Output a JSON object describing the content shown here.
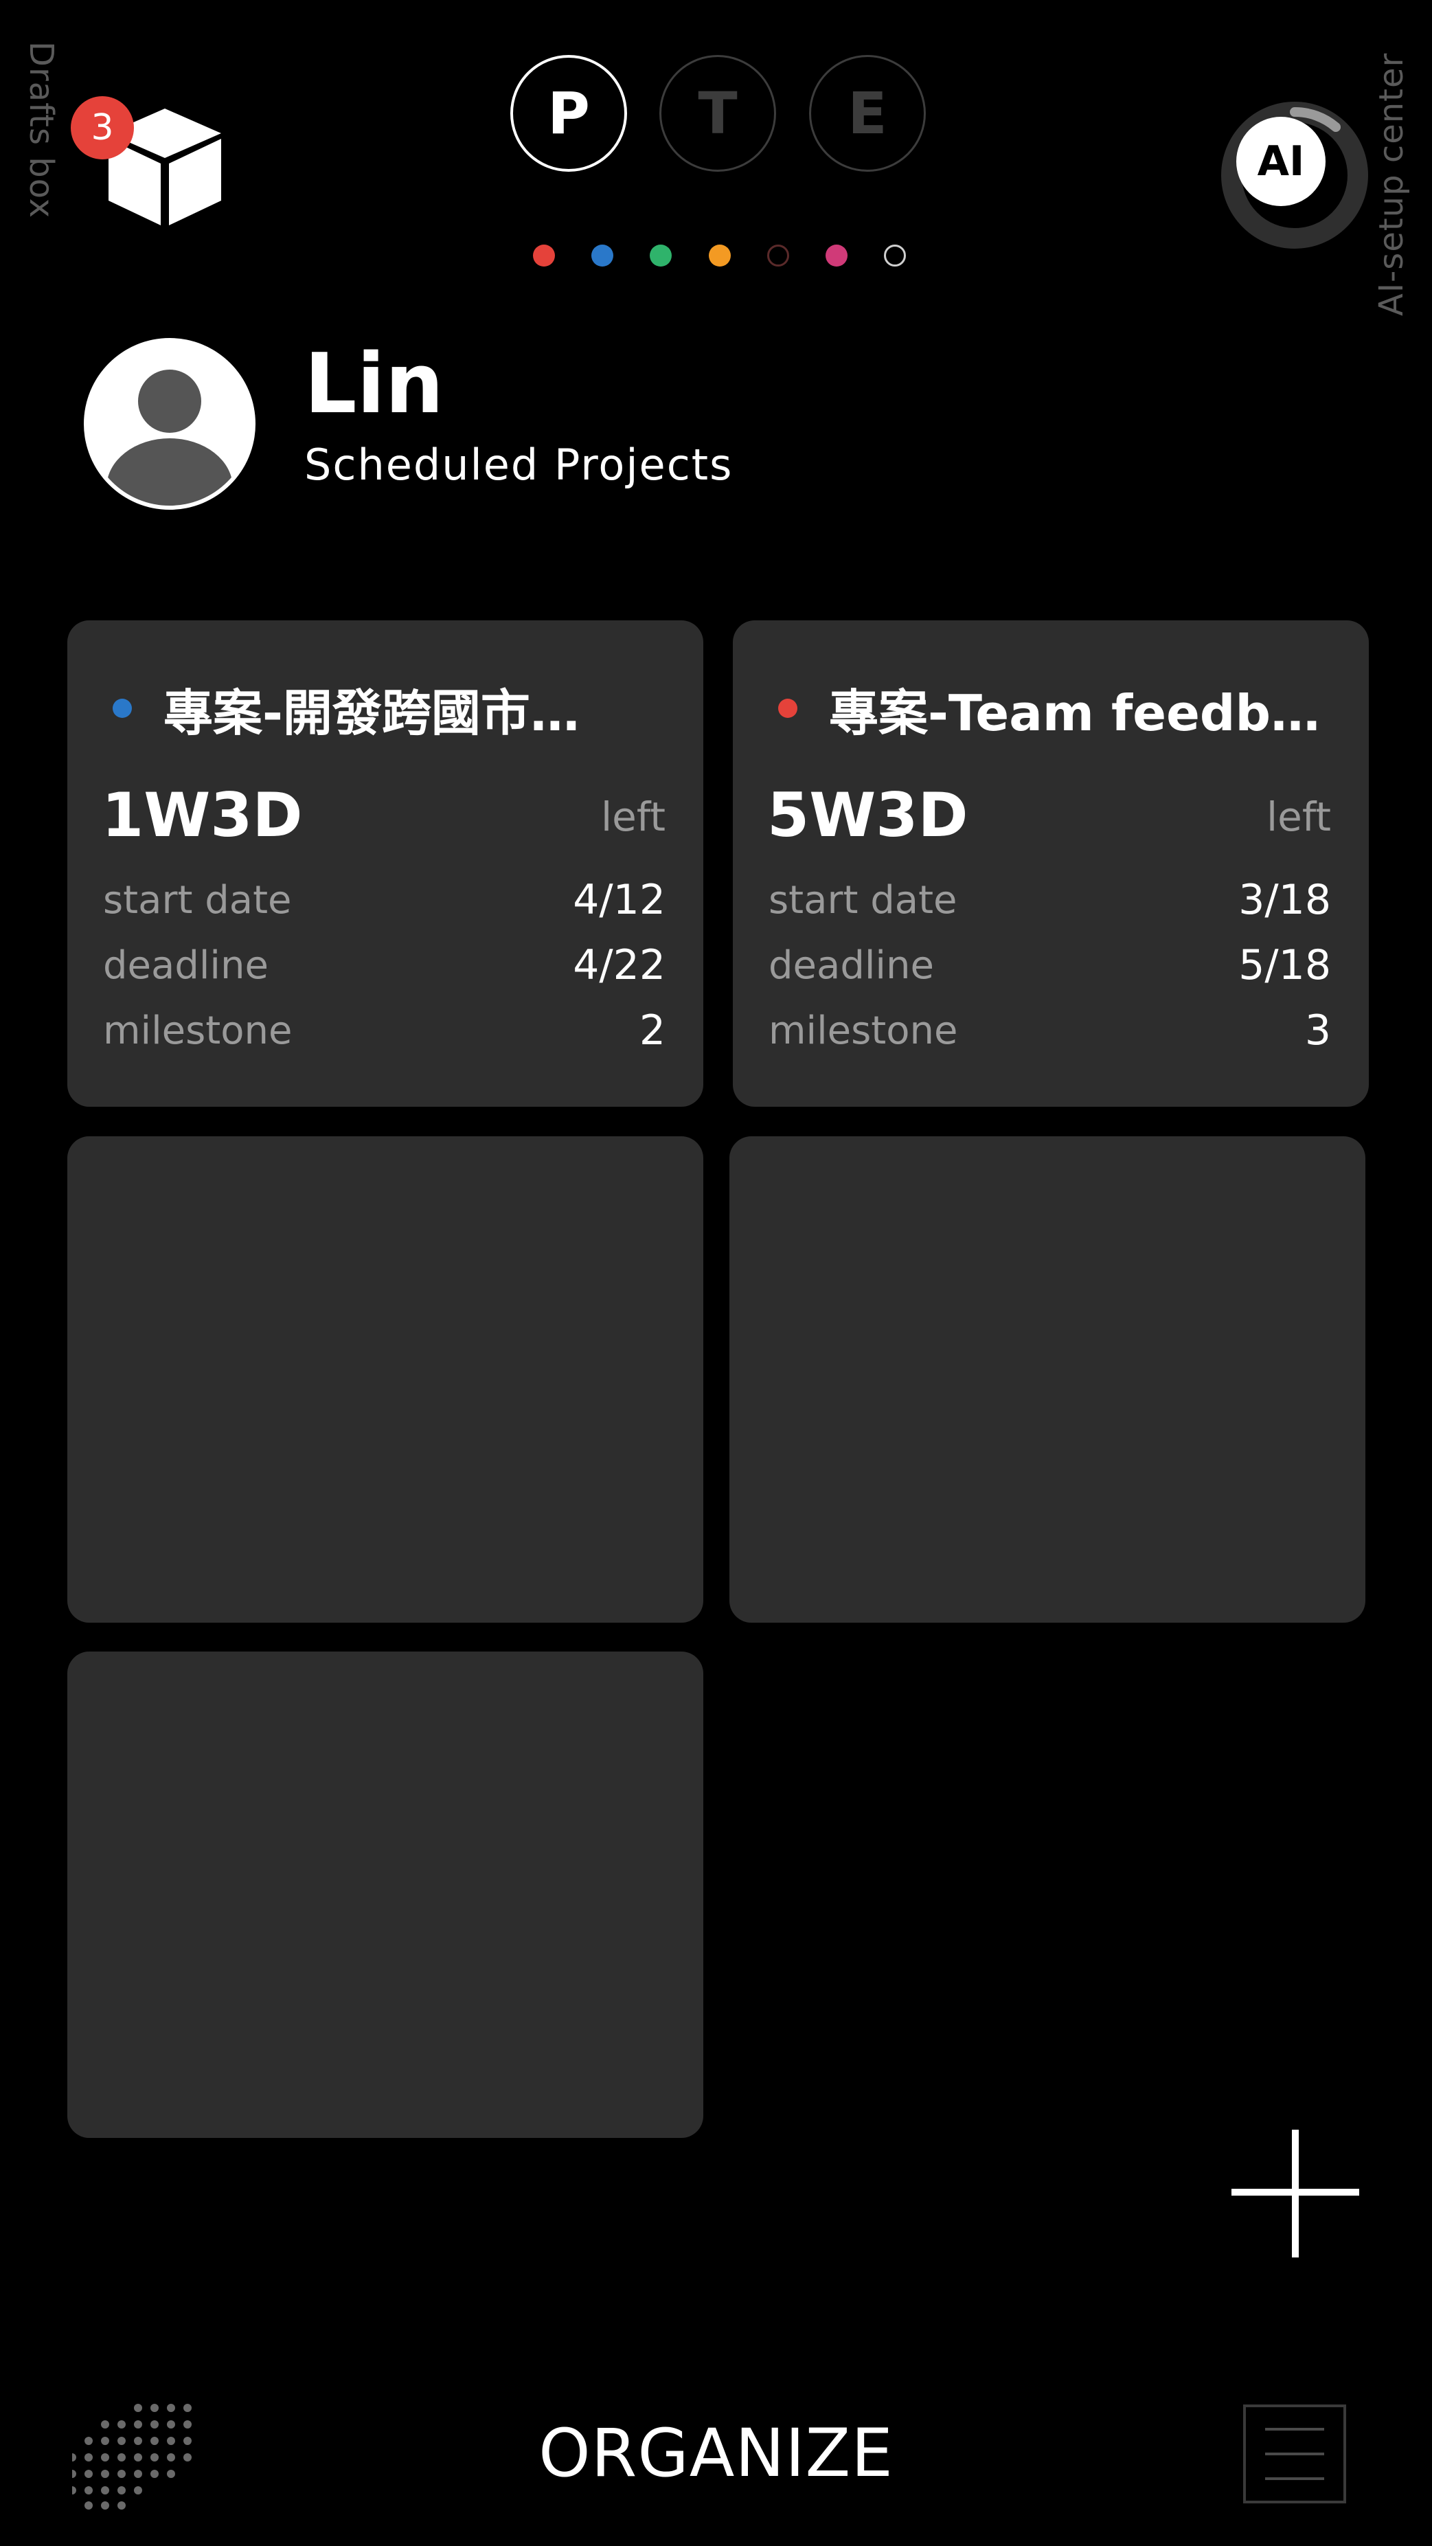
{
  "drafts": {
    "label": "Drafts box",
    "badge_count": "3",
    "icon": "cube-icon"
  },
  "mode_tabs": [
    {
      "label": "P",
      "active": true
    },
    {
      "label": "T",
      "active": false
    },
    {
      "label": "E",
      "active": false
    }
  ],
  "color_filters": [
    "#e5423a",
    "#2a78c9",
    "#2fb36b",
    "#f39a23",
    "#4a2a2a",
    "#d03a78",
    "#ffffff"
  ],
  "ai": {
    "label": "AI-setup center",
    "button": "AI"
  },
  "profile": {
    "name": "Lin",
    "subtitle": "Scheduled Projects"
  },
  "projects": [
    {
      "title": "專案-開發跨國市…",
      "dot_color": "#2a78c9",
      "time_left": "1W3D",
      "left_word": "left",
      "rows": [
        {
          "label": "start date",
          "value": "4/12"
        },
        {
          "label": "deadline",
          "value": "4/22"
        },
        {
          "label": "milestone",
          "value": "2"
        }
      ]
    },
    {
      "title": "專案-Team feedb…",
      "dot_color": "#e5423a",
      "time_left": "5W3D",
      "left_word": "left",
      "rows": [
        {
          "label": "start date",
          "value": "3/18"
        },
        {
          "label": "deadline",
          "value": "5/18"
        },
        {
          "label": "milestone",
          "value": "3"
        }
      ]
    }
  ],
  "bottom": {
    "title": "ORGANIZE"
  }
}
